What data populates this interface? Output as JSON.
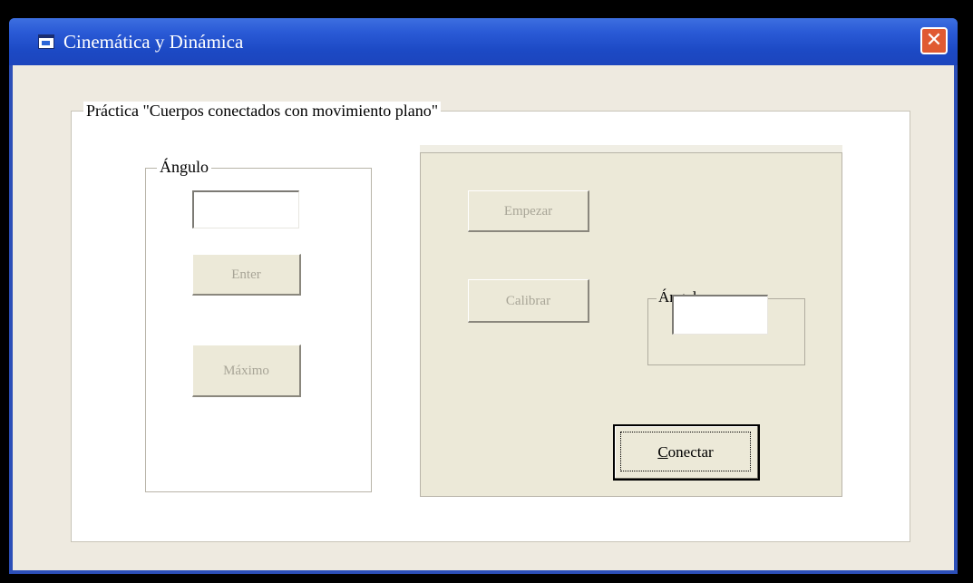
{
  "window": {
    "title": "Cinemática y Dinámica",
    "close_label": "✕"
  },
  "practice": {
    "label": "Práctica \"Cuerpos conectados con movimiento plano\""
  },
  "left_panel": {
    "legend": "Ángulo",
    "input_value": "",
    "enter_label": "Enter",
    "maximo_label": "Máximo"
  },
  "right_panel": {
    "empezar_label": "Empezar",
    "calibrar_label": "Calibrar",
    "angle_legend": "Ángulo",
    "angle_value": "",
    "conectar_first": "C",
    "conectar_rest": "onectar"
  },
  "colors": {
    "titlebar": "#2a5ad6",
    "close": "#e05a32",
    "client_bg": "#eeeae0",
    "disabled_text": "#a8a597"
  }
}
